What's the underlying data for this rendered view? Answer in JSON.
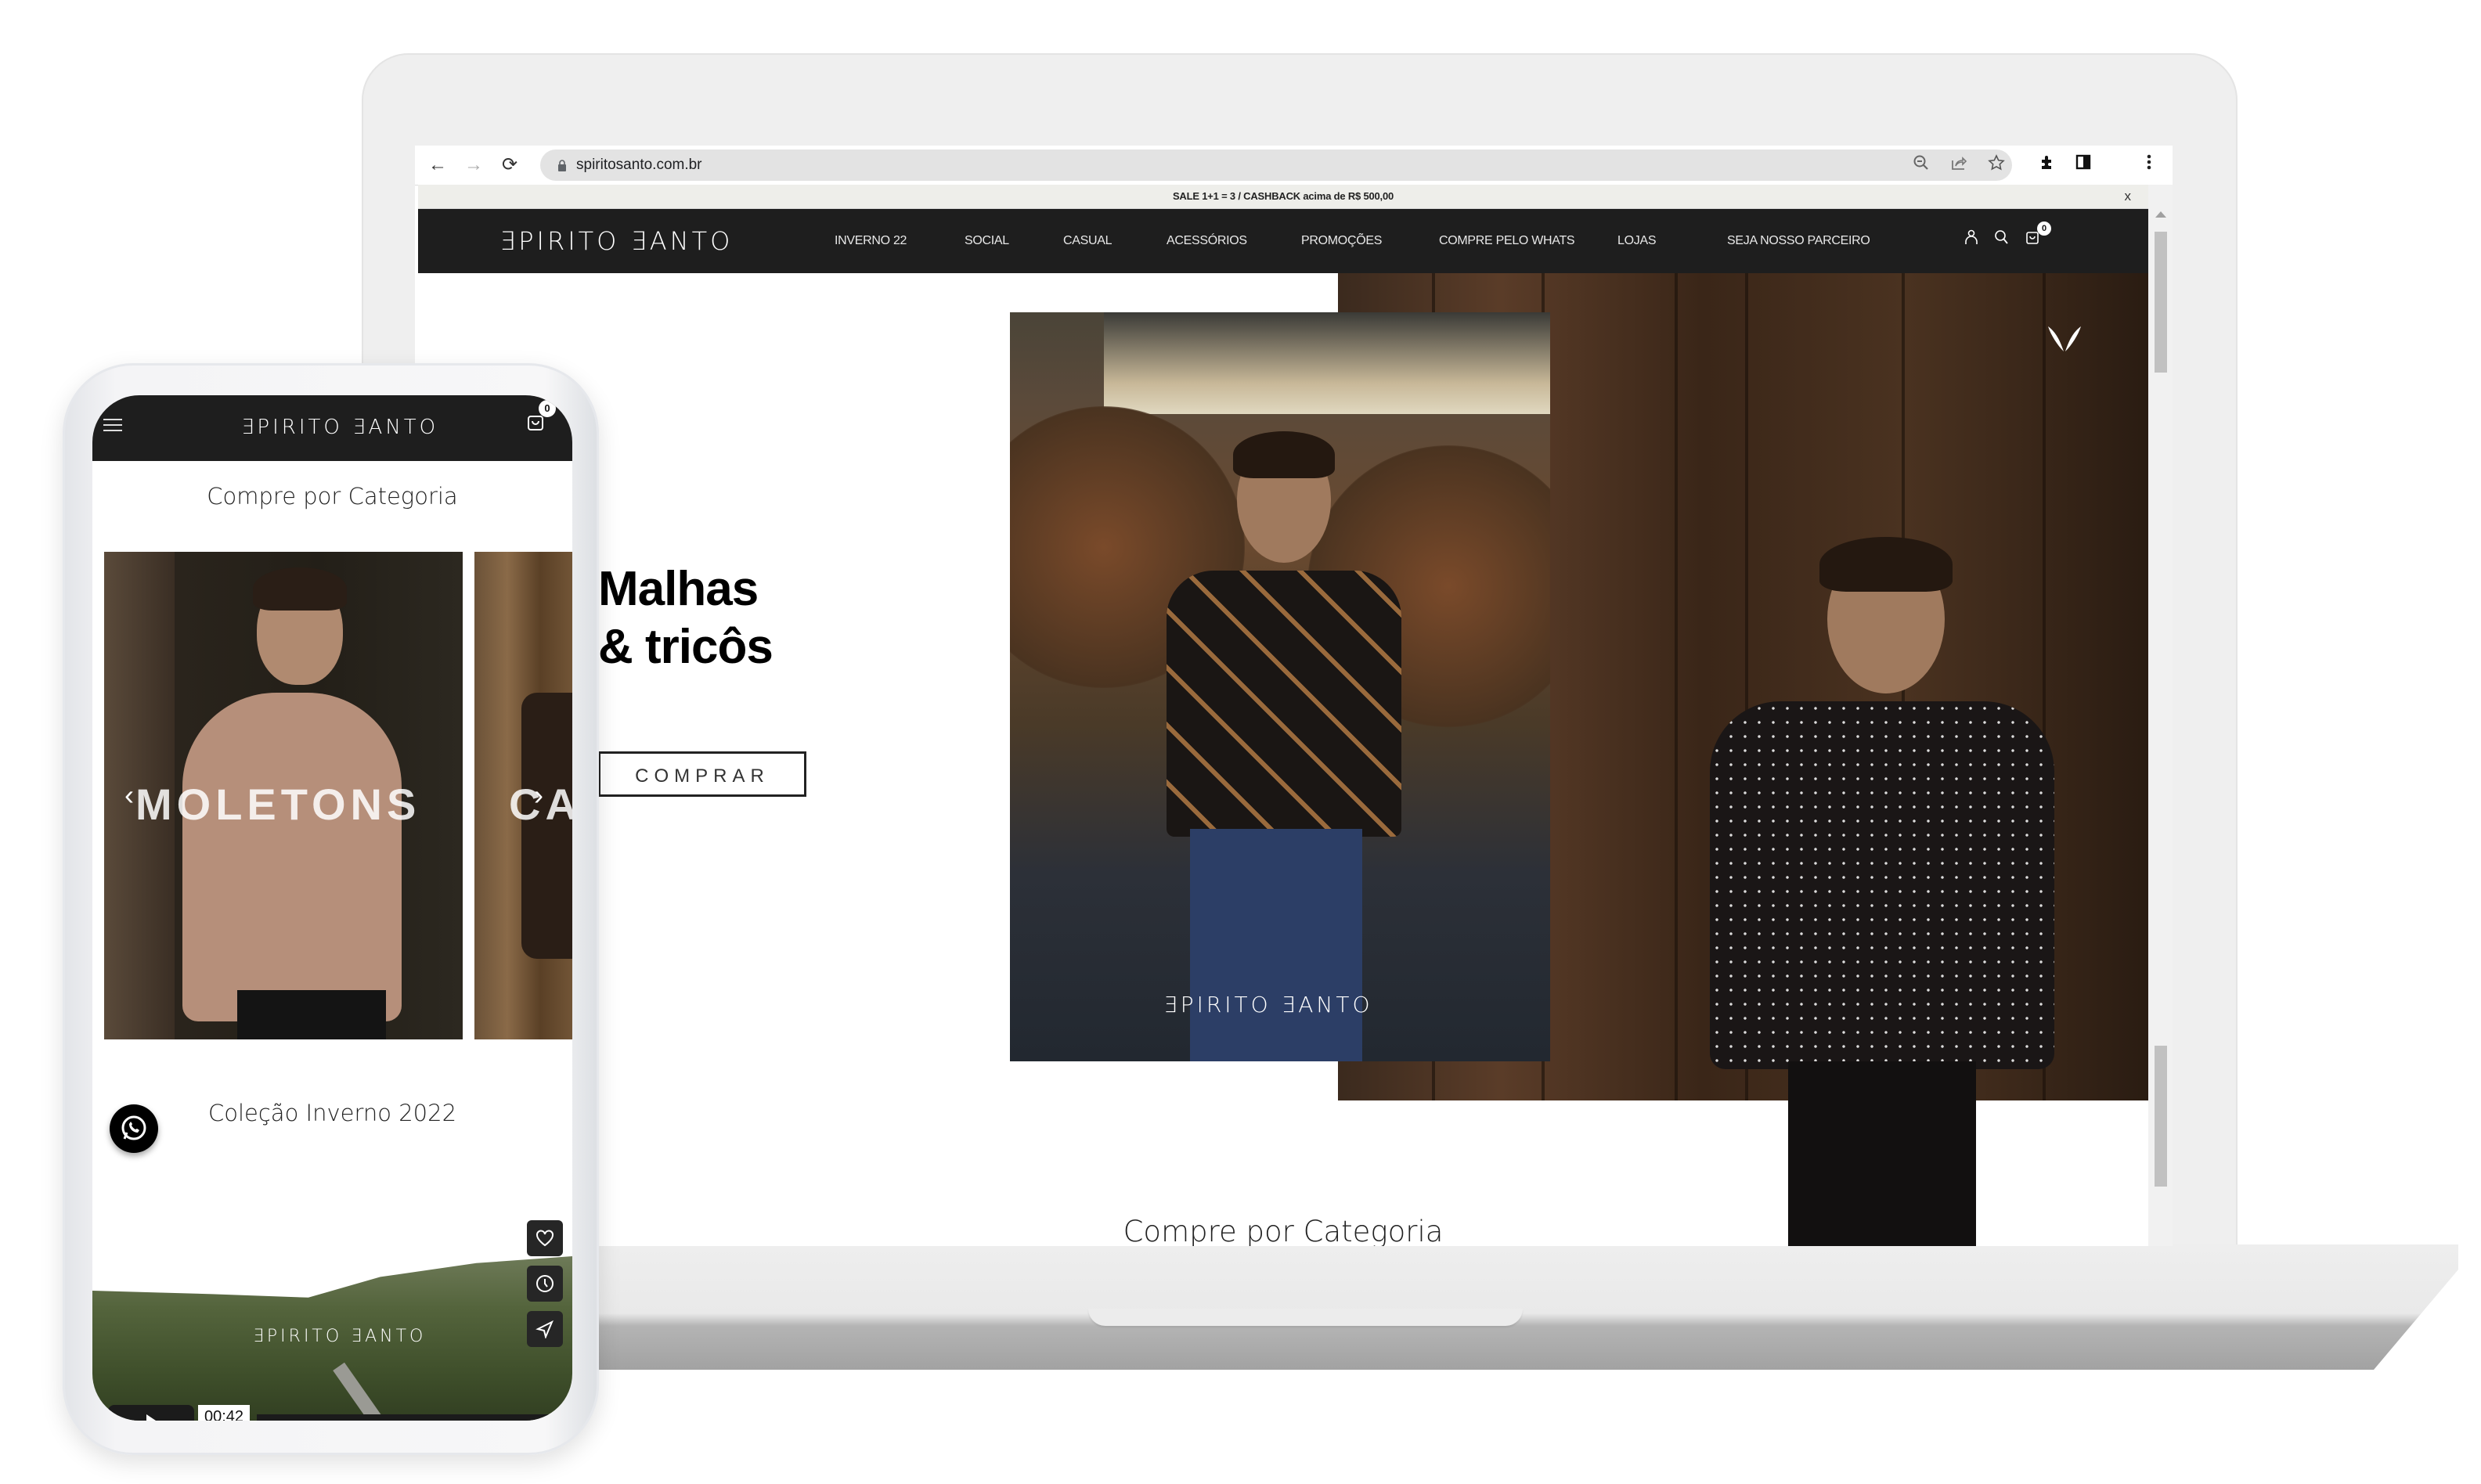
{
  "browser": {
    "url": "spiritosanto.com.br",
    "nav": {
      "back": "←",
      "forward": "→",
      "reload": "⟳"
    },
    "omnibox_icons": [
      "zoom-out-icon",
      "share-icon",
      "bookmark-star-icon"
    ],
    "toolbar_icons": [
      "extensions-icon",
      "side-panel-icon",
      "menu-icon"
    ]
  },
  "site": {
    "brand": "ƎPIRITO ƎANTO",
    "promo": {
      "text": "SALE 1+1 = 3 / CASHBACK acima de R$ 500,00",
      "close": "x"
    },
    "nav_items": [
      {
        "label": "INVERNO 22"
      },
      {
        "label": "SOCIAL"
      },
      {
        "label": "CASUAL"
      },
      {
        "label": "ACESSÓRIOS"
      },
      {
        "label": "PROMOÇÕES"
      },
      {
        "label": "COMPRE PELO WHATS"
      },
      {
        "label": "LOJAS"
      },
      {
        "label": "SEJA NOSSO PARCEIRO"
      }
    ],
    "header_icons": {
      "account": "account-icon",
      "search": "search-icon",
      "cart": "cart-icon"
    },
    "cart_count": "0",
    "hero": {
      "title_line1": "Malhas",
      "title_line2": "& tricôs",
      "cta": "COMPRAR",
      "image_logo": "ƎPIRITO ƎANTO"
    },
    "section_title": "Compre por Categoria"
  },
  "mobile": {
    "brand": "ƎPIRITO ƎANTO",
    "cart_count": "0",
    "section_title": "Compre por Categoria",
    "categories": [
      {
        "label": "MOLETONS"
      },
      {
        "label": "CA"
      }
    ],
    "carousel": {
      "prev": "‹",
      "next": "›"
    },
    "collection_title": "Coleção Inverno 2022",
    "video": {
      "logo": "ƎPIRITO ƎANTO",
      "time": "00:42",
      "side_buttons": [
        "like-icon",
        "watch-later-icon",
        "share-icon"
      ]
    }
  }
}
